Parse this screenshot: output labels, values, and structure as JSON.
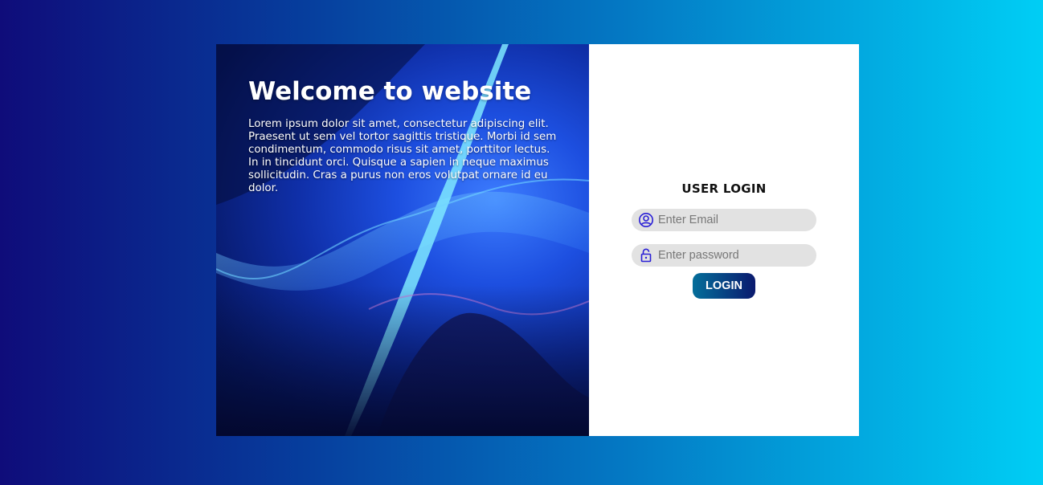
{
  "hero": {
    "title": "Welcome to website",
    "body": "Lorem ipsum dolor sit amet, consectetur adipiscing elit. Praesent ut sem vel tortor sagittis tristique. Morbi id sem condimentum, commodo risus sit amet, porttitor lectus. In in tincidunt orci. Quisque a sapien in neque maximus sollicitudin. Cras a purus non eros volutpat ornare id eu dolor."
  },
  "login": {
    "title": "USER LOGIN",
    "email_placeholder": "Enter Email",
    "email_icon": "user-circle-icon",
    "password_placeholder": "Enter password",
    "password_icon": "lock-open-icon",
    "button_label": "LOGIN"
  },
  "colors": {
    "icon": "#2a1fd6",
    "button_start": "#046e9a",
    "button_end": "#0a1a6e",
    "field_bg": "#e2e2e2"
  }
}
